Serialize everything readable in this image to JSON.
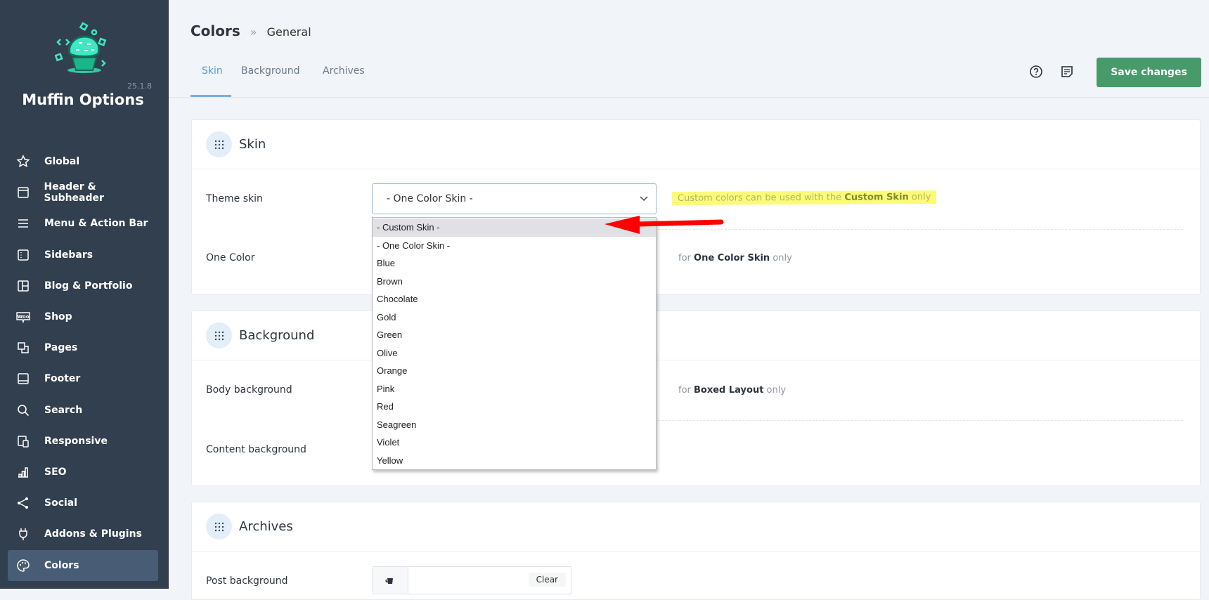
{
  "app": {
    "title": "Muffin Options",
    "version": "25.1.8"
  },
  "sidebar": {
    "items": [
      {
        "label": "Global",
        "icon": "star-icon"
      },
      {
        "label": "Header & Subheader",
        "icon": "header-layout-icon"
      },
      {
        "label": "Menu & Action Bar",
        "icon": "menu-icon"
      },
      {
        "label": "Sidebars",
        "icon": "sidebar-icon"
      },
      {
        "label": "Blog & Portfolio",
        "icon": "grid-layout-icon"
      },
      {
        "label": "Shop",
        "icon": "woo-icon"
      },
      {
        "label": "Pages",
        "icon": "pages-icon"
      },
      {
        "label": "Footer",
        "icon": "footer-icon"
      },
      {
        "label": "Search",
        "icon": "search-icon"
      },
      {
        "label": "Responsive",
        "icon": "responsive-icon"
      },
      {
        "label": "SEO",
        "icon": "seo-icon"
      },
      {
        "label": "Social",
        "icon": "share-icon"
      },
      {
        "label": "Addons & Plugins",
        "icon": "plug-icon"
      },
      {
        "label": "Colors",
        "icon": "palette-icon",
        "active": true
      }
    ]
  },
  "breadcrumb": {
    "main": "Colors",
    "sep": "»",
    "sub": "General"
  },
  "tabs": [
    {
      "label": "Skin",
      "active": true
    },
    {
      "label": "Background"
    },
    {
      "label": "Archives"
    }
  ],
  "toolbar": {
    "save_label": "Save changes",
    "accent": "#479b6a"
  },
  "skin": {
    "title": "Skin",
    "theme_skin_label": "Theme skin",
    "theme_skin_value": "- One Color Skin -",
    "options": [
      "- Custom Skin -",
      "- One Color Skin -",
      "Blue",
      "Brown",
      "Chocolate",
      "Gold",
      "Green",
      "Olive",
      "Orange",
      "Pink",
      "Red",
      "Seagreen",
      "Violet",
      "Yellow"
    ],
    "note_pre": "Custom colors can be used with the ",
    "note_bold": "Custom Skin",
    "note_post": " only",
    "one_color_label": "One Color",
    "one_color_note_pre": "for ",
    "one_color_note_bold": "One Color Skin",
    "one_color_note_post": " only"
  },
  "background": {
    "title": "Background",
    "body_label": "Body background",
    "body_note_pre": "for ",
    "body_note_bold": "Boxed Layout",
    "body_note_post": " only",
    "content_label": "Content background"
  },
  "archives": {
    "title": "Archives",
    "post_label": "Post background",
    "clear_label": "Clear"
  }
}
